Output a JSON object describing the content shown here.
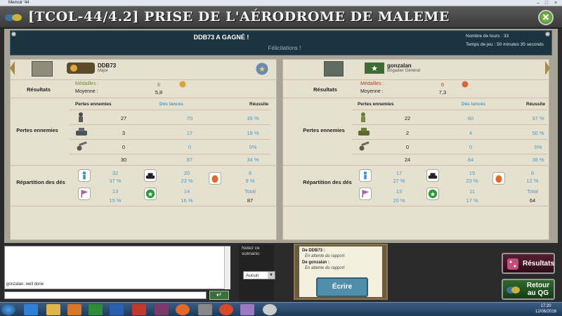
{
  "window": {
    "title": "Memoir '44"
  },
  "banner": {
    "title": "[TCOL-44/4.2] PRISE DE L'AÉRODROME DE MALEME",
    "close_label": "✕"
  },
  "header": {
    "winner": "DDB73 A GAGNÉ !",
    "congrats": "Félicitations !",
    "turns": "Nombre de tours : 33",
    "playtime": "Temps de jeu : 50 minutes 35 seconds"
  },
  "labels": {
    "results": "Résultats",
    "medals": "Médailles :",
    "average": "Moyenne :",
    "losses_header": "Pertes ennemies",
    "dice_header": "Dés lancés",
    "success_header": "Réussite",
    "losses": "Pertes ennemies",
    "dice_split": "Répartition des dés",
    "total": "Total"
  },
  "players": [
    {
      "name": "DDB73",
      "rank": "Major",
      "medals": "8",
      "average": "5,8",
      "rows": [
        {
          "losses": "27",
          "dice": "70",
          "success": "39 %"
        },
        {
          "losses": "3",
          "dice": "17",
          "success": "18 %"
        },
        {
          "losses": "0",
          "dice": "0",
          "success": "0%"
        }
      ],
      "totals": {
        "losses": "30",
        "dice": "87",
        "success": "34 %"
      },
      "dice_split": {
        "inf": "32",
        "inf_pct": "37 %",
        "tank": "20",
        "tank_pct": "23 %",
        "gren": "8",
        "gren_pct": "9 %",
        "flag": "13",
        "flag_pct": "15 %",
        "star": "14",
        "star_pct": "16 %",
        "total": "87"
      }
    },
    {
      "name": "gonzalan",
      "rank": "Brigadier Général",
      "medals": "6",
      "average": "7,3",
      "rows": [
        {
          "losses": "22",
          "dice": "60",
          "success": "37 %"
        },
        {
          "losses": "2",
          "dice": "4",
          "success": "50 %"
        },
        {
          "losses": "0",
          "dice": "0",
          "success": "0%"
        }
      ],
      "totals": {
        "losses": "24",
        "dice": "64",
        "success": "38 %"
      },
      "dice_split": {
        "inf": "17",
        "inf_pct": "27 %",
        "tank": "15",
        "tank_pct": "23 %",
        "gren": "8",
        "gren_pct": "12 %",
        "flag": "13",
        "flag_pct": "20 %",
        "star": "11",
        "star_pct": "17 %",
        "total": "64"
      }
    }
  ],
  "chat": {
    "message": "gonzalan: well done",
    "send": "↵"
  },
  "rate": {
    "prompt": "Notez ce scénario:",
    "selected": "Aucun"
  },
  "report": {
    "p1": "De DDB73 :",
    "p1_status": "En attente du rapport",
    "p2": "De gonzalan :",
    "p2_status": "En attente du rapport",
    "write": "Écrire"
  },
  "buttons": {
    "results": "Résultats",
    "back": "Retour au QG"
  },
  "clock": {
    "time": "17:20",
    "date": "12/06/2016"
  }
}
